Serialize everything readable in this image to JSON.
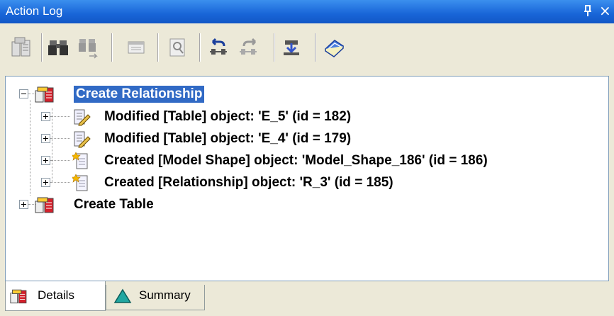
{
  "window": {
    "title": "Action Log",
    "pin_icon": "pin-icon",
    "close_glyph": "×",
    "title_bar_color": "#1a63d6"
  },
  "toolbar": {
    "buttons": [
      {
        "name": "document-tree-button",
        "icon": "documents-icon"
      },
      {
        "name": "find-button",
        "icon": "binoculars-icon"
      },
      {
        "name": "find-next-button",
        "icon": "binoculars-next-icon"
      },
      {
        "name": "view-button",
        "icon": "window-icon"
      },
      {
        "name": "properties-button",
        "icon": "page-magnify-icon"
      },
      {
        "name": "undo-button",
        "icon": "undo-icon"
      },
      {
        "name": "redo-button",
        "icon": "redo-icon"
      },
      {
        "name": "import-button",
        "icon": "download-icon"
      },
      {
        "name": "help-button",
        "icon": "help-book-icon"
      }
    ]
  },
  "tree": {
    "items": [
      {
        "label": "Create Relationship",
        "level": 0,
        "expanded": true,
        "selected": true,
        "icon": "action-group-icon"
      },
      {
        "label": "Modified [Table] object: 'E_5' (id = 182)",
        "level": 1,
        "expanded": false,
        "icon": "modified-object-icon"
      },
      {
        "label": "Modified [Table] object: 'E_4' (id = 179)",
        "level": 1,
        "expanded": false,
        "icon": "modified-object-icon"
      },
      {
        "label": "Created [Model Shape] object: 'Model_Shape_186' (id = 186)",
        "level": 1,
        "expanded": false,
        "icon": "created-object-icon"
      },
      {
        "label": "Created [Relationship] object: 'R_3' (id = 185)",
        "level": 1,
        "expanded": false,
        "icon": "created-object-icon"
      },
      {
        "label": "Create Table",
        "level": 0,
        "expanded": false,
        "selected": false,
        "icon": "action-group-icon"
      }
    ]
  },
  "tabs": [
    {
      "label": "Details",
      "active": true,
      "icon": "action-group-icon"
    },
    {
      "label": "Summary",
      "active": false,
      "icon": "triangle-icon"
    }
  ],
  "colors": {
    "selection": "#316ac5",
    "accent_red": "#d4202b",
    "triangle_teal": "#21a7a1"
  }
}
